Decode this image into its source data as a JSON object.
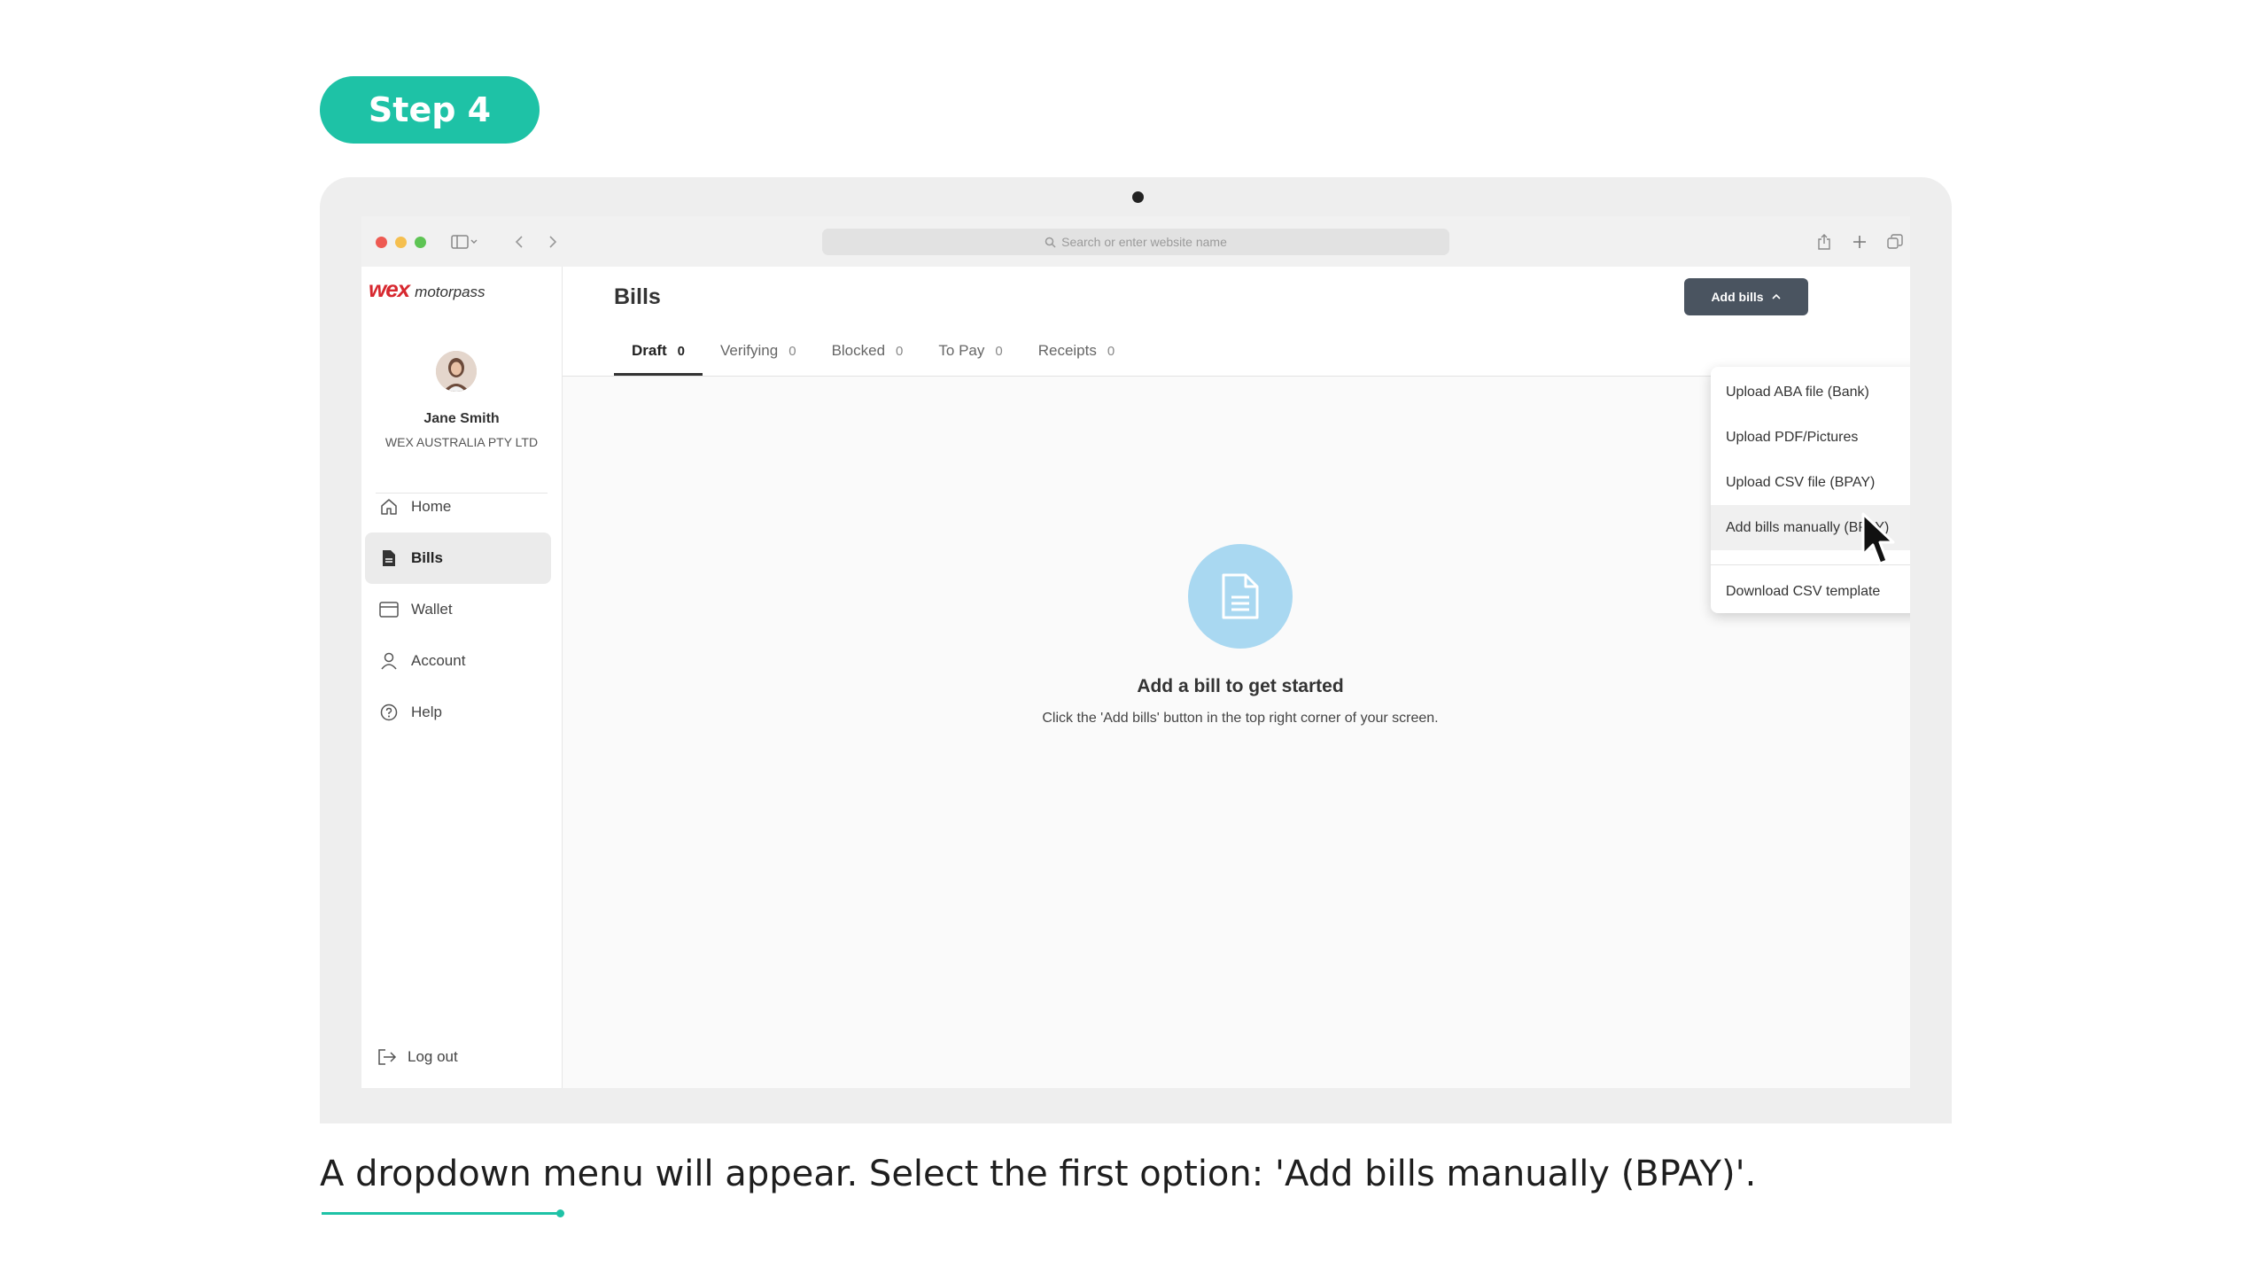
{
  "step": {
    "label": "Step 4"
  },
  "browser": {
    "url_placeholder": "Search or enter website name"
  },
  "brand": {
    "logo_main": "wex",
    "logo_sub": "motorpass"
  },
  "user": {
    "name": "Jane Smith",
    "company": "WEX AUSTRALIA PTY LTD"
  },
  "sidebar": {
    "items": [
      {
        "label": "Home",
        "icon": "home-icon"
      },
      {
        "label": "Bills",
        "icon": "document-icon",
        "active": true
      },
      {
        "label": "Wallet",
        "icon": "wallet-icon"
      },
      {
        "label": "Account",
        "icon": "user-icon"
      },
      {
        "label": "Help",
        "icon": "help-icon"
      }
    ],
    "logout": "Log out"
  },
  "main": {
    "title": "Bills",
    "tabs": [
      {
        "label": "Draft",
        "count": "0",
        "active": true
      },
      {
        "label": "Verifying",
        "count": "0"
      },
      {
        "label": "Blocked",
        "count": "0"
      },
      {
        "label": "To Pay",
        "count": "0"
      },
      {
        "label": "Receipts",
        "count": "0"
      }
    ],
    "add_bills_label": "Add bills",
    "empty_title": "Add a bill to get started",
    "empty_text": "Click the 'Add bills' button in the top right corner of your screen."
  },
  "dropdown": {
    "items": [
      {
        "label": "Upload ABA file (Bank)"
      },
      {
        "label": "Upload PDF/Pictures"
      },
      {
        "label": "Upload CSV file (BPAY)"
      },
      {
        "label": "Add bills manually (BPAY)",
        "hovered": true
      }
    ],
    "download": "Download CSV template"
  },
  "caption": "A dropdown menu will appear. Select the first option: 'Add bills manually (BPAY)'.",
  "colors": {
    "accent": "#1ec2a6",
    "brand_red": "#d7282f",
    "button_dark": "#4a5460",
    "empty_icon_bg": "#a9d8f1"
  }
}
